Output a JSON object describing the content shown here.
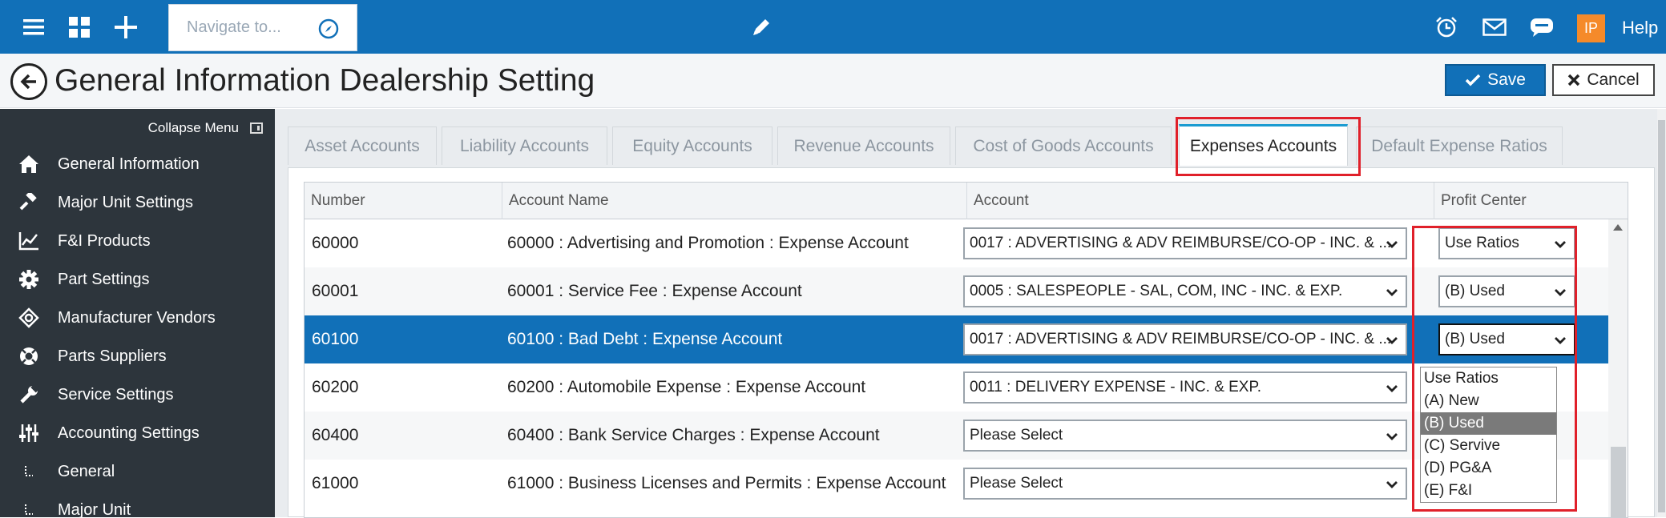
{
  "topbar": {
    "menu_icon": "hamburger-icon",
    "apps_icon": "grid-icon",
    "add_icon": "plus-icon",
    "navigate_placeholder": "Navigate to...",
    "compass_icon": "compass-icon",
    "edit_icon": "pencil-icon",
    "alarm_icon": "alarm-clock-icon",
    "mail_icon": "envelope-icon",
    "chat_icon": "chat-icon",
    "avatar_initials": "IP",
    "help_label": "Help",
    "accent_color": "#1170b8",
    "avatar_color": "#f58a2a"
  },
  "header": {
    "title": "General Information Dealership Setting",
    "save_label": "Save",
    "cancel_label": "Cancel"
  },
  "sidebar": {
    "collapse_label": "Collapse Menu",
    "items": [
      {
        "label": "General Information",
        "icon": "home-icon"
      },
      {
        "label": "Major Unit Settings",
        "icon": "gavel-icon"
      },
      {
        "label": "F&I Products",
        "icon": "line-chart-icon"
      },
      {
        "label": "Part Settings",
        "icon": "gear-icon"
      },
      {
        "label": "Manufacturer Vendors",
        "icon": "crosshair-icon"
      },
      {
        "label": "Parts Suppliers",
        "icon": "lifebuoy-icon"
      },
      {
        "label": "Service Settings",
        "icon": "wrench-icon"
      },
      {
        "label": "Accounting Settings",
        "icon": "sliders-icon"
      },
      {
        "label": "General",
        "icon": "sub-item-icon"
      },
      {
        "label": "Major Unit",
        "icon": "sub-item-icon"
      }
    ]
  },
  "tabs": [
    {
      "label": "Asset Accounts"
    },
    {
      "label": "Liability Accounts"
    },
    {
      "label": "Equity Accounts"
    },
    {
      "label": "Revenue Accounts"
    },
    {
      "label": "Cost of Goods Accounts"
    },
    {
      "label": "Expenses Accounts"
    },
    {
      "label": "Default Expense Ratios"
    }
  ],
  "grid": {
    "columns": [
      "Number",
      "Account Name",
      "Account",
      "Profit Center"
    ],
    "rows": [
      {
        "number": "60000",
        "name": "60000 : Advertising and Promotion : Expense Account",
        "account": "0017 : ADVERTISING & ADV REIMBURSE/CO-OP - INC. & ...",
        "profit_center": "Use Ratios"
      },
      {
        "number": "60001",
        "name": "60001 : Service Fee : Expense Account",
        "account": "0005 : SALESPEOPLE - SAL, COM, INC - INC. & EXP.",
        "profit_center": "(B) Used"
      },
      {
        "number": "60100",
        "name": "60100 : Bad Debt : Expense Account",
        "account": "0017 : ADVERTISING & ADV REIMBURSE/CO-OP - INC. & ...",
        "profit_center": "(B) Used"
      },
      {
        "number": "60200",
        "name": "60200 : Automobile Expense : Expense Account",
        "account": "0011 : DELIVERY EXPENSE - INC. & EXP.",
        "profit_center": ""
      },
      {
        "number": "60400",
        "name": "60400 : Bank Service Charges : Expense Account",
        "account": "Please Select",
        "profit_center": ""
      },
      {
        "number": "61000",
        "name": "61000 : Business Licenses and Permits : Expense Account",
        "account": "Please Select",
        "profit_center": ""
      }
    ]
  },
  "profit_center_dropdown": {
    "options": [
      "Use Ratios",
      "(A) New",
      "(B) Used",
      "(C) Servive",
      "(D) PG&A",
      "(E) F&I"
    ],
    "highlighted": "(B) Used"
  }
}
